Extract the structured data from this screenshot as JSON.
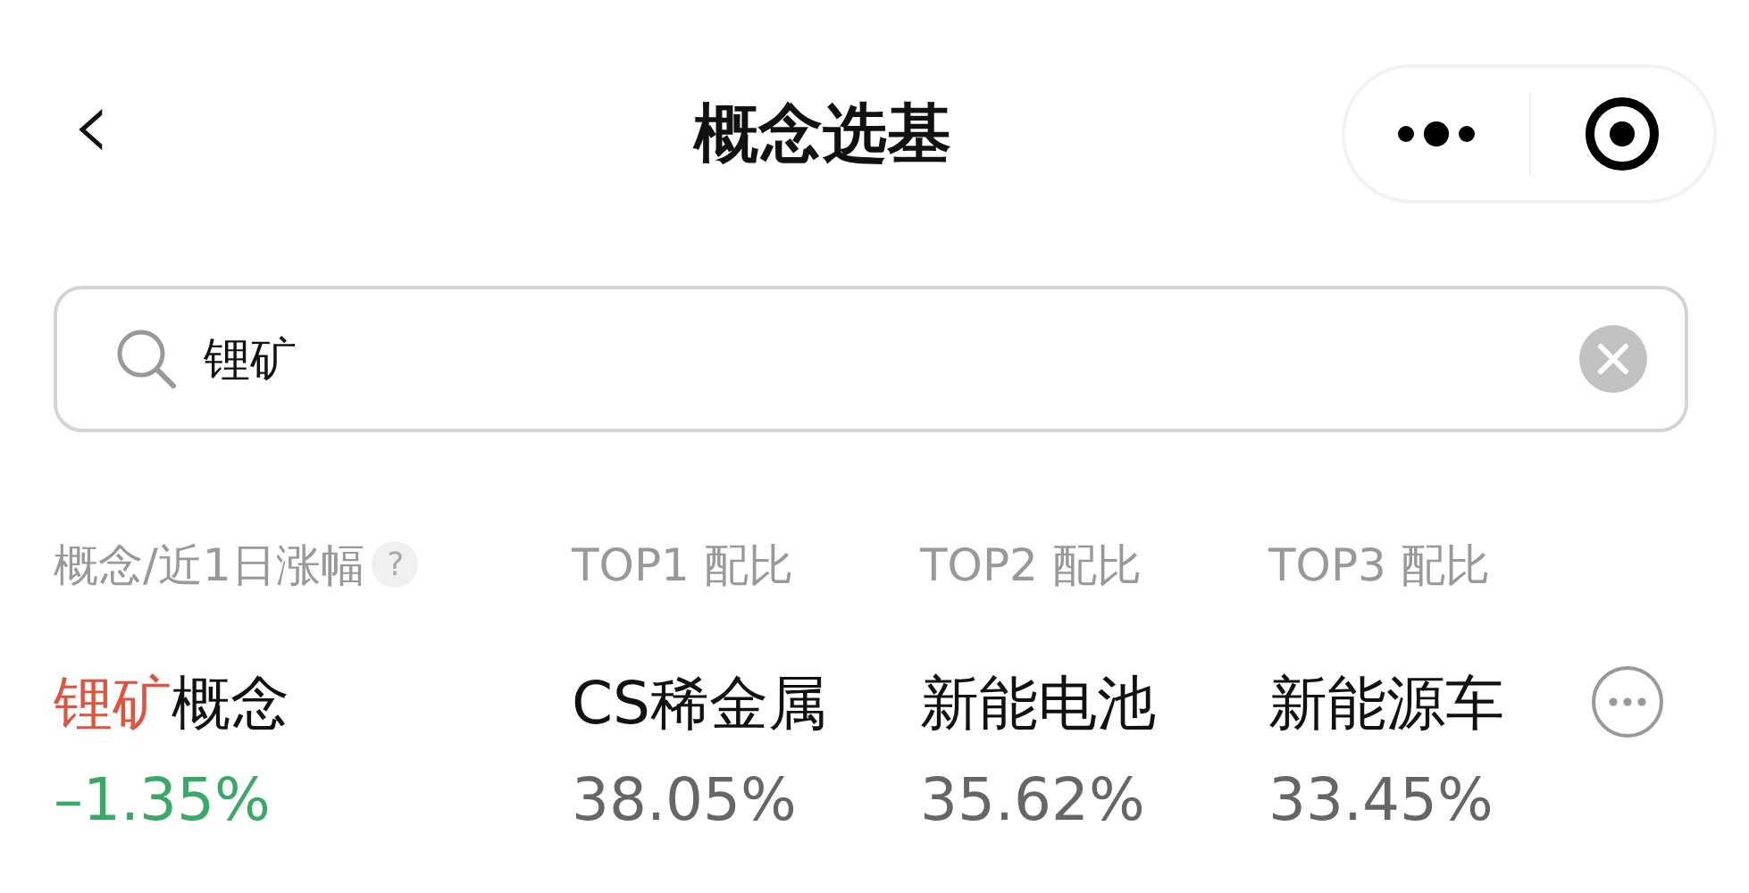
{
  "nav_bar": {
    "back": "‹",
    "title": "概念选基"
  },
  "search": {
    "value": "锂矿"
  },
  "table": {
    "columns": [
      {
        "label": "概念/近1日涨幅",
        "help": "?"
      },
      {
        "label": "TOP1 配比"
      },
      {
        "label": "TOP2 配比"
      },
      {
        "label": "TOP3 配比"
      }
    ],
    "rows": [
      {
        "concept_match": "锂矿",
        "concept_rest": "概念",
        "change": "–1.35%",
        "color": "#3aa866",
        "funds": [
          {
            "name": "CS稀金属",
            "ratio": "38.05%"
          },
          {
            "name": "新能电池",
            "ratio": "35.62%"
          },
          {
            "name": "新能源车",
            "ratio": "33.45%"
          }
        ]
      }
    ]
  }
}
